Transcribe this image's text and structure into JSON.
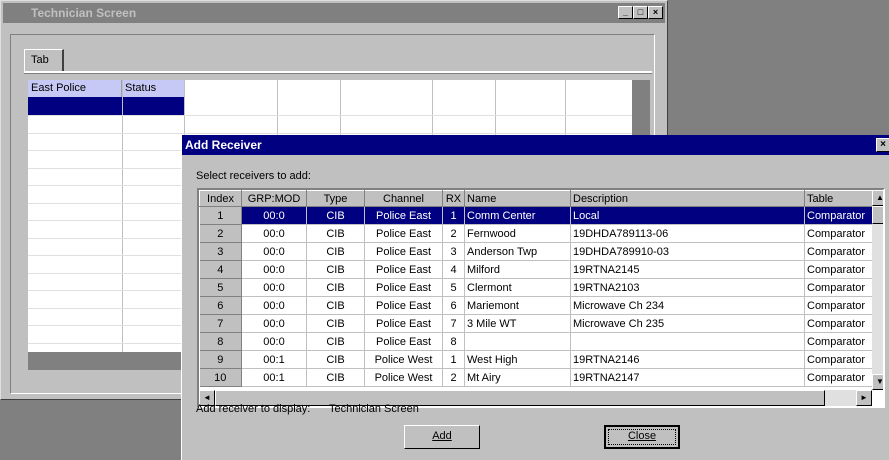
{
  "tech_window": {
    "title": "Technician Screen",
    "tab_label": "Tab",
    "grid_headers": {
      "col1": "East Police",
      "col2": "Status"
    }
  },
  "dialog": {
    "title": "Add Receiver",
    "instruction": "Select receivers to add:",
    "columns": [
      "Index",
      "GRP:MOD",
      "Type",
      "Channel",
      "RX",
      "Name",
      "Description",
      "Table"
    ],
    "rows": [
      [
        "1",
        "00:0",
        "CIB",
        "Police East",
        "1",
        "Comm Center",
        "Local",
        "Comparator"
      ],
      [
        "2",
        "00:0",
        "CIB",
        "Police East",
        "2",
        "Fernwood",
        "19DHDA789113-06",
        "Comparator"
      ],
      [
        "3",
        "00:0",
        "CIB",
        "Police East",
        "3",
        "Anderson Twp",
        "19DHDA789910-03",
        "Comparator"
      ],
      [
        "4",
        "00:0",
        "CIB",
        "Police East",
        "4",
        "Milford",
        "19RTNA2145",
        "Comparator"
      ],
      [
        "5",
        "00:0",
        "CIB",
        "Police East",
        "5",
        "Clermont",
        "19RTNA2103",
        "Comparator"
      ],
      [
        "6",
        "00:0",
        "CIB",
        "Police East",
        "6",
        "Mariemont",
        "Microwave Ch 234",
        "Comparator"
      ],
      [
        "7",
        "00:0",
        "CIB",
        "Police East",
        "7",
        "3 Mile WT",
        "Microwave Ch 235",
        "Comparator"
      ],
      [
        "8",
        "00:0",
        "CIB",
        "Police East",
        "8",
        "",
        "",
        "Comparator"
      ],
      [
        "9",
        "00:1",
        "CIB",
        "Police West",
        "1",
        "West High",
        "19RTNA2146",
        "Comparator"
      ],
      [
        "10",
        "00:1",
        "CIB",
        "Police West",
        "2",
        "Mt Airy",
        "19RTNA2147",
        "Comparator"
      ]
    ],
    "selected_row_index": 0,
    "display_label": "Add receiver to display:",
    "display_value": "Technician Screen",
    "add_label": "Add",
    "close_label": "Close"
  }
}
